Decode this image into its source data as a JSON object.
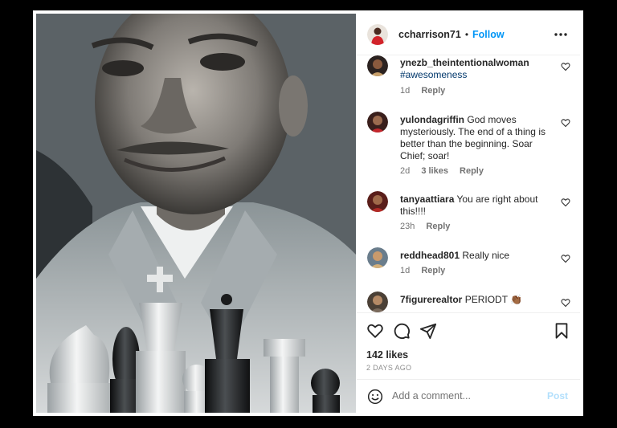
{
  "post": {
    "username": "ccharrison71",
    "separator": "•",
    "follow_label": "Follow",
    "more_icon": "more-horizontal-icon"
  },
  "comments": [
    {
      "username": "ynezb_theintentionalwoman",
      "text": "",
      "tag": "#awesomeness",
      "age": "1d",
      "likes": "",
      "reply": "Reply"
    },
    {
      "username": "yulondagriffin",
      "text": "God moves mysteriously. The end of a thing is better than the beginning. Soar Chief; soar!",
      "age": "2d",
      "likes": "3 likes",
      "reply": "Reply"
    },
    {
      "username": "tanyaattiara",
      "text": "You are right about this!!!!",
      "age": "23h",
      "likes": "",
      "reply": "Reply"
    },
    {
      "username": "reddhead801",
      "text": "Really nice",
      "age": "1d",
      "likes": "",
      "reply": "Reply"
    },
    {
      "username": "7figurerealtor",
      "text": "PERIODT 👏🏾",
      "age": "",
      "likes": "",
      "reply": ""
    }
  ],
  "actions": {
    "likes": "142 likes",
    "posted": "2 DAYS AGO",
    "comment_placeholder": "Add a comment...",
    "post_label": "Post"
  },
  "colors": {
    "accent": "#0095f6",
    "post_disabled": "#b2dffc",
    "hashtag": "#00376b"
  }
}
